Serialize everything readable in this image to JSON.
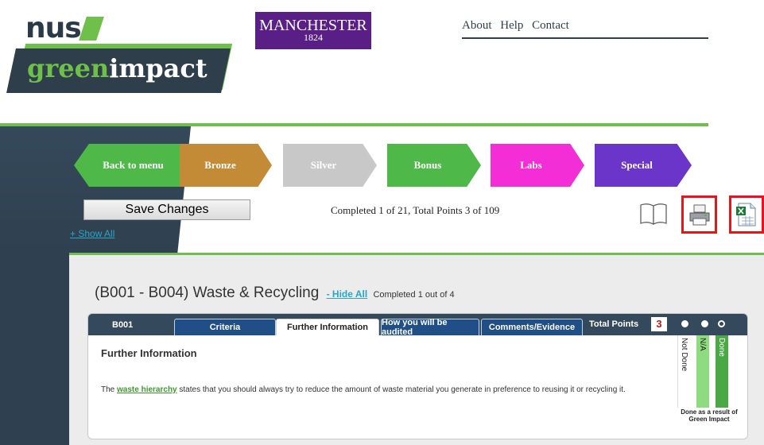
{
  "header": {
    "logo_nus": "nus",
    "logo_green": "green",
    "logo_impact": "impact",
    "manchester_name": "MANCHESTER",
    "manchester_year": "1824",
    "nav": [
      "About",
      "Help",
      "Contact"
    ]
  },
  "levels": [
    {
      "label": "Back to menu",
      "color": "#4eb848"
    },
    {
      "label": "Bronze",
      "color": "#c38b36"
    },
    {
      "label": "Silver",
      "color": "#c8c8c8"
    },
    {
      "label": "Bonus",
      "color": "#4eb848"
    },
    {
      "label": "Labs",
      "color": "#f42ed6"
    },
    {
      "label": "Special",
      "color": "#6a35c8"
    }
  ],
  "toolbar": {
    "save_label": "Save Changes",
    "show_all": "+ Show All",
    "completed": "Completed 1 of 21, Total Points 3 of 109",
    "icons": [
      "book-icon",
      "printer-icon",
      "excel-icon"
    ]
  },
  "section": {
    "title": "(B001 - B004) Waste & Recycling",
    "hide_all": "- Hide All",
    "completed": "Completed 1 out of 4"
  },
  "card": {
    "code": "B001",
    "tabs": [
      "Criteria",
      "Further Information",
      "How you will be audited",
      "Comments/Evidence"
    ],
    "active_tab": "Further Information",
    "total_points_label": "Total Points",
    "total_points_value": "3",
    "heading": "Further Information",
    "text_before": "The ",
    "link_text": "waste hierarchy",
    "text_after": " states that you should always try to reduce the amount of waste material you generate in preference to reusing it or recycling it.",
    "status_columns": [
      "Not Done",
      "N/A",
      "Done"
    ],
    "selected_status": "Done",
    "status_note": "Done as a result of Green Impact"
  }
}
